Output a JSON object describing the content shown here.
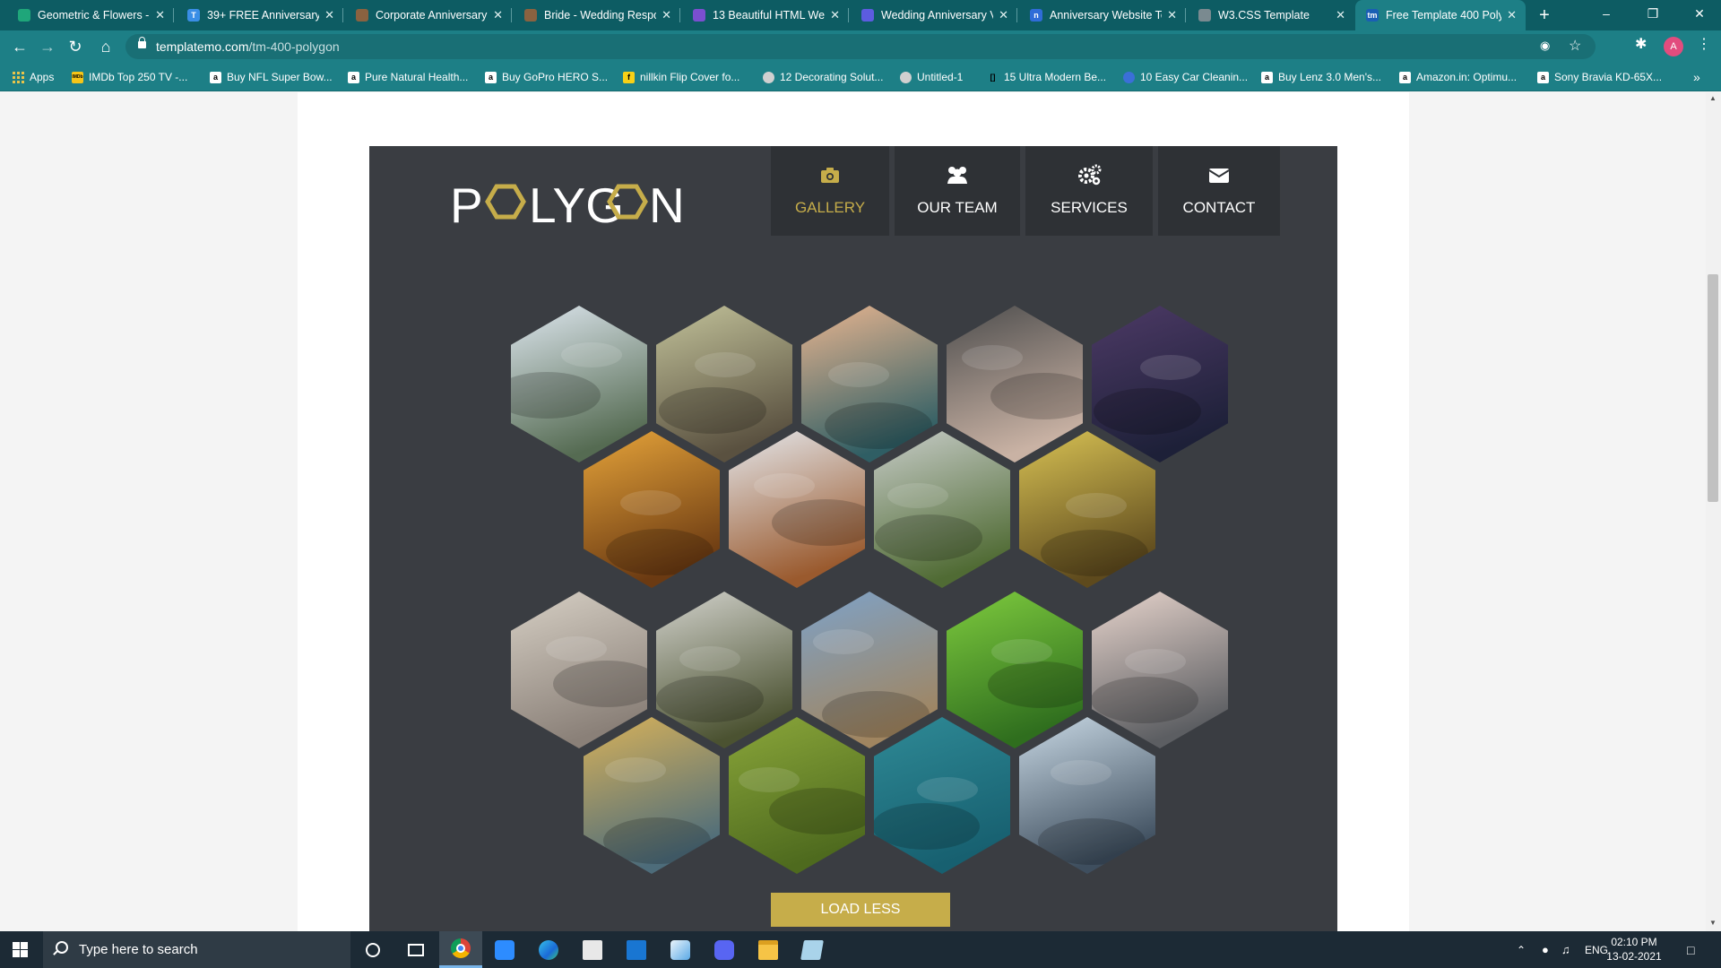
{
  "browser": {
    "tabs": [
      {
        "title": "Geometric & Flowers -",
        "favicon": "green-leaf-icon",
        "color": "#1fa67a",
        "active": false
      },
      {
        "title": "39+ FREE Anniversary I",
        "favicon": "t-letter-icon",
        "color": "#3a8ee6",
        "glyph": "T",
        "active": false
      },
      {
        "title": "Corporate Anniversary",
        "favicon": "bookmark-icon",
        "color": "#8a6240",
        "active": false
      },
      {
        "title": "Bride - Wedding Respo",
        "favicon": "bookmark-icon",
        "color": "#8a6240",
        "active": false
      },
      {
        "title": "13 Beautiful HTML Wed",
        "favicon": "purple-logo-icon",
        "color": "#7b4fd0",
        "active": false
      },
      {
        "title": "Wedding Anniversary V",
        "favicon": "purple-square-icon",
        "color": "#5c5ce0",
        "active": false
      },
      {
        "title": "Anniversary Website Te",
        "favicon": "n-letter-icon",
        "color": "#2f6cd8",
        "glyph": "n",
        "active": false
      },
      {
        "title": "W3.CSS Template",
        "favicon": "globe-icon",
        "color": "#7a8a90",
        "active": false
      },
      {
        "title": "Free Template 400 Poly",
        "favicon": "tm-icon",
        "color": "#1a5fb4",
        "glyph": "tm",
        "active": true
      }
    ],
    "url": {
      "host": "templatemo.com",
      "path": "/tm-400-polygon"
    },
    "profile_initial": "A",
    "bookmarks": [
      {
        "label": "Apps",
        "icon": "apps-grid-icon"
      },
      {
        "label": "IMDb Top 250 TV -...",
        "icon": "imdb-icon",
        "color": "#f5c518",
        "glyph": "IMDb"
      },
      {
        "label": "Buy NFL Super Bow...",
        "icon": "amazon-icon",
        "color": "#ffffff",
        "glyph": "a"
      },
      {
        "label": "Pure Natural Health...",
        "icon": "amazon-icon",
        "color": "#ffffff",
        "glyph": "a"
      },
      {
        "label": "Buy GoPro HERO S...",
        "icon": "amazon-icon",
        "color": "#ffffff",
        "glyph": "a"
      },
      {
        "label": "nillkin Flip Cover fo...",
        "icon": "flipkart-icon",
        "color": "#f7d117",
        "glyph": "f"
      },
      {
        "label": "12 Decorating Solut...",
        "icon": "globe-icon",
        "color": "#d0d0d0",
        "glyph": ""
      },
      {
        "label": "Untitled-1",
        "icon": "globe-icon",
        "color": "#d0d0d0",
        "glyph": ""
      },
      {
        "label": "15 Ultra Modern Be...",
        "icon": "bracket-icon",
        "color": "#1d7f86",
        "glyph": "[]"
      },
      {
        "label": "10 Easy Car Cleanin...",
        "icon": "blue-circle-icon",
        "color": "#3b6fd8",
        "glyph": ""
      },
      {
        "label": "Buy Lenz 3.0 Men's...",
        "icon": "amazon-icon",
        "color": "#ffffff",
        "glyph": "a"
      },
      {
        "label": "Amazon.in: Optimu...",
        "icon": "amazon-icon",
        "color": "#ffffff",
        "glyph": "a"
      },
      {
        "label": "Sony Bravia KD-65X...",
        "icon": "amazon-icon",
        "color": "#ffffff",
        "glyph": "a"
      }
    ]
  },
  "site": {
    "logo_text": "POLYGON",
    "accent": "#c6ad4a",
    "nav": [
      {
        "label": "GALLERY",
        "icon": "camera-icon",
        "active": true
      },
      {
        "label": "OUR TEAM",
        "icon": "team-icon",
        "active": false
      },
      {
        "label": "SERVICES",
        "icon": "gears-icon",
        "active": false
      },
      {
        "label": "CONTACT",
        "icon": "envelope-icon",
        "active": false
      }
    ],
    "gallery": [
      {
        "name": "mountain-road",
        "top": "#dde6ee",
        "bottom": "#556b52"
      },
      {
        "name": "rock-cliffs",
        "top": "#c2c29a",
        "bottom": "#5a5140"
      },
      {
        "name": "mountain-lake",
        "top": "#e8b590",
        "bottom": "#2f5e64"
      },
      {
        "name": "dandelion",
        "top": "#4d4d4d",
        "bottom": "#c9b2a4"
      },
      {
        "name": "city-bridge-night",
        "top": "#4d3a66",
        "bottom": "#1d2038"
      },
      {
        "name": "autumn-leaves",
        "top": "#e6a43a",
        "bottom": "#6b3a12"
      },
      {
        "name": "desk-glasses",
        "top": "#e4e6ea",
        "bottom": "#9a5a2e"
      },
      {
        "name": "meadow-rocks",
        "top": "#c7ccc8",
        "bottom": "#506b34"
      },
      {
        "name": "tea-pot",
        "top": "#d8c254",
        "bottom": "#5e4a1d"
      },
      {
        "name": "tricycle",
        "top": "#d6cfc4",
        "bottom": "#8a8078"
      },
      {
        "name": "hills",
        "top": "#d2d2cc",
        "bottom": "#4b5231"
      },
      {
        "name": "field-grass",
        "top": "#7ea2c8",
        "bottom": "#a08560"
      },
      {
        "name": "green-leaf-drops",
        "top": "#7ecb3e",
        "bottom": "#2f6e1e"
      },
      {
        "name": "sea-rocks",
        "top": "#e7d4cc",
        "bottom": "#5c5e62"
      },
      {
        "name": "canal-houses",
        "top": "#d8b25a",
        "bottom": "#4d6c7a"
      },
      {
        "name": "green-bushes",
        "top": "#8aa63a",
        "bottom": "#4e6a1e"
      },
      {
        "name": "boat-water",
        "top": "#2f8a96",
        "bottom": "#176070"
      },
      {
        "name": "bowl-steam",
        "top": "#c8d8e4",
        "bottom": "#3e4e5e"
      }
    ],
    "load_button": "LOAD LESS"
  },
  "taskbar": {
    "search_placeholder": "Type here to search",
    "language": "ENG",
    "time": "02:10 PM",
    "date": "13-02-2021"
  }
}
